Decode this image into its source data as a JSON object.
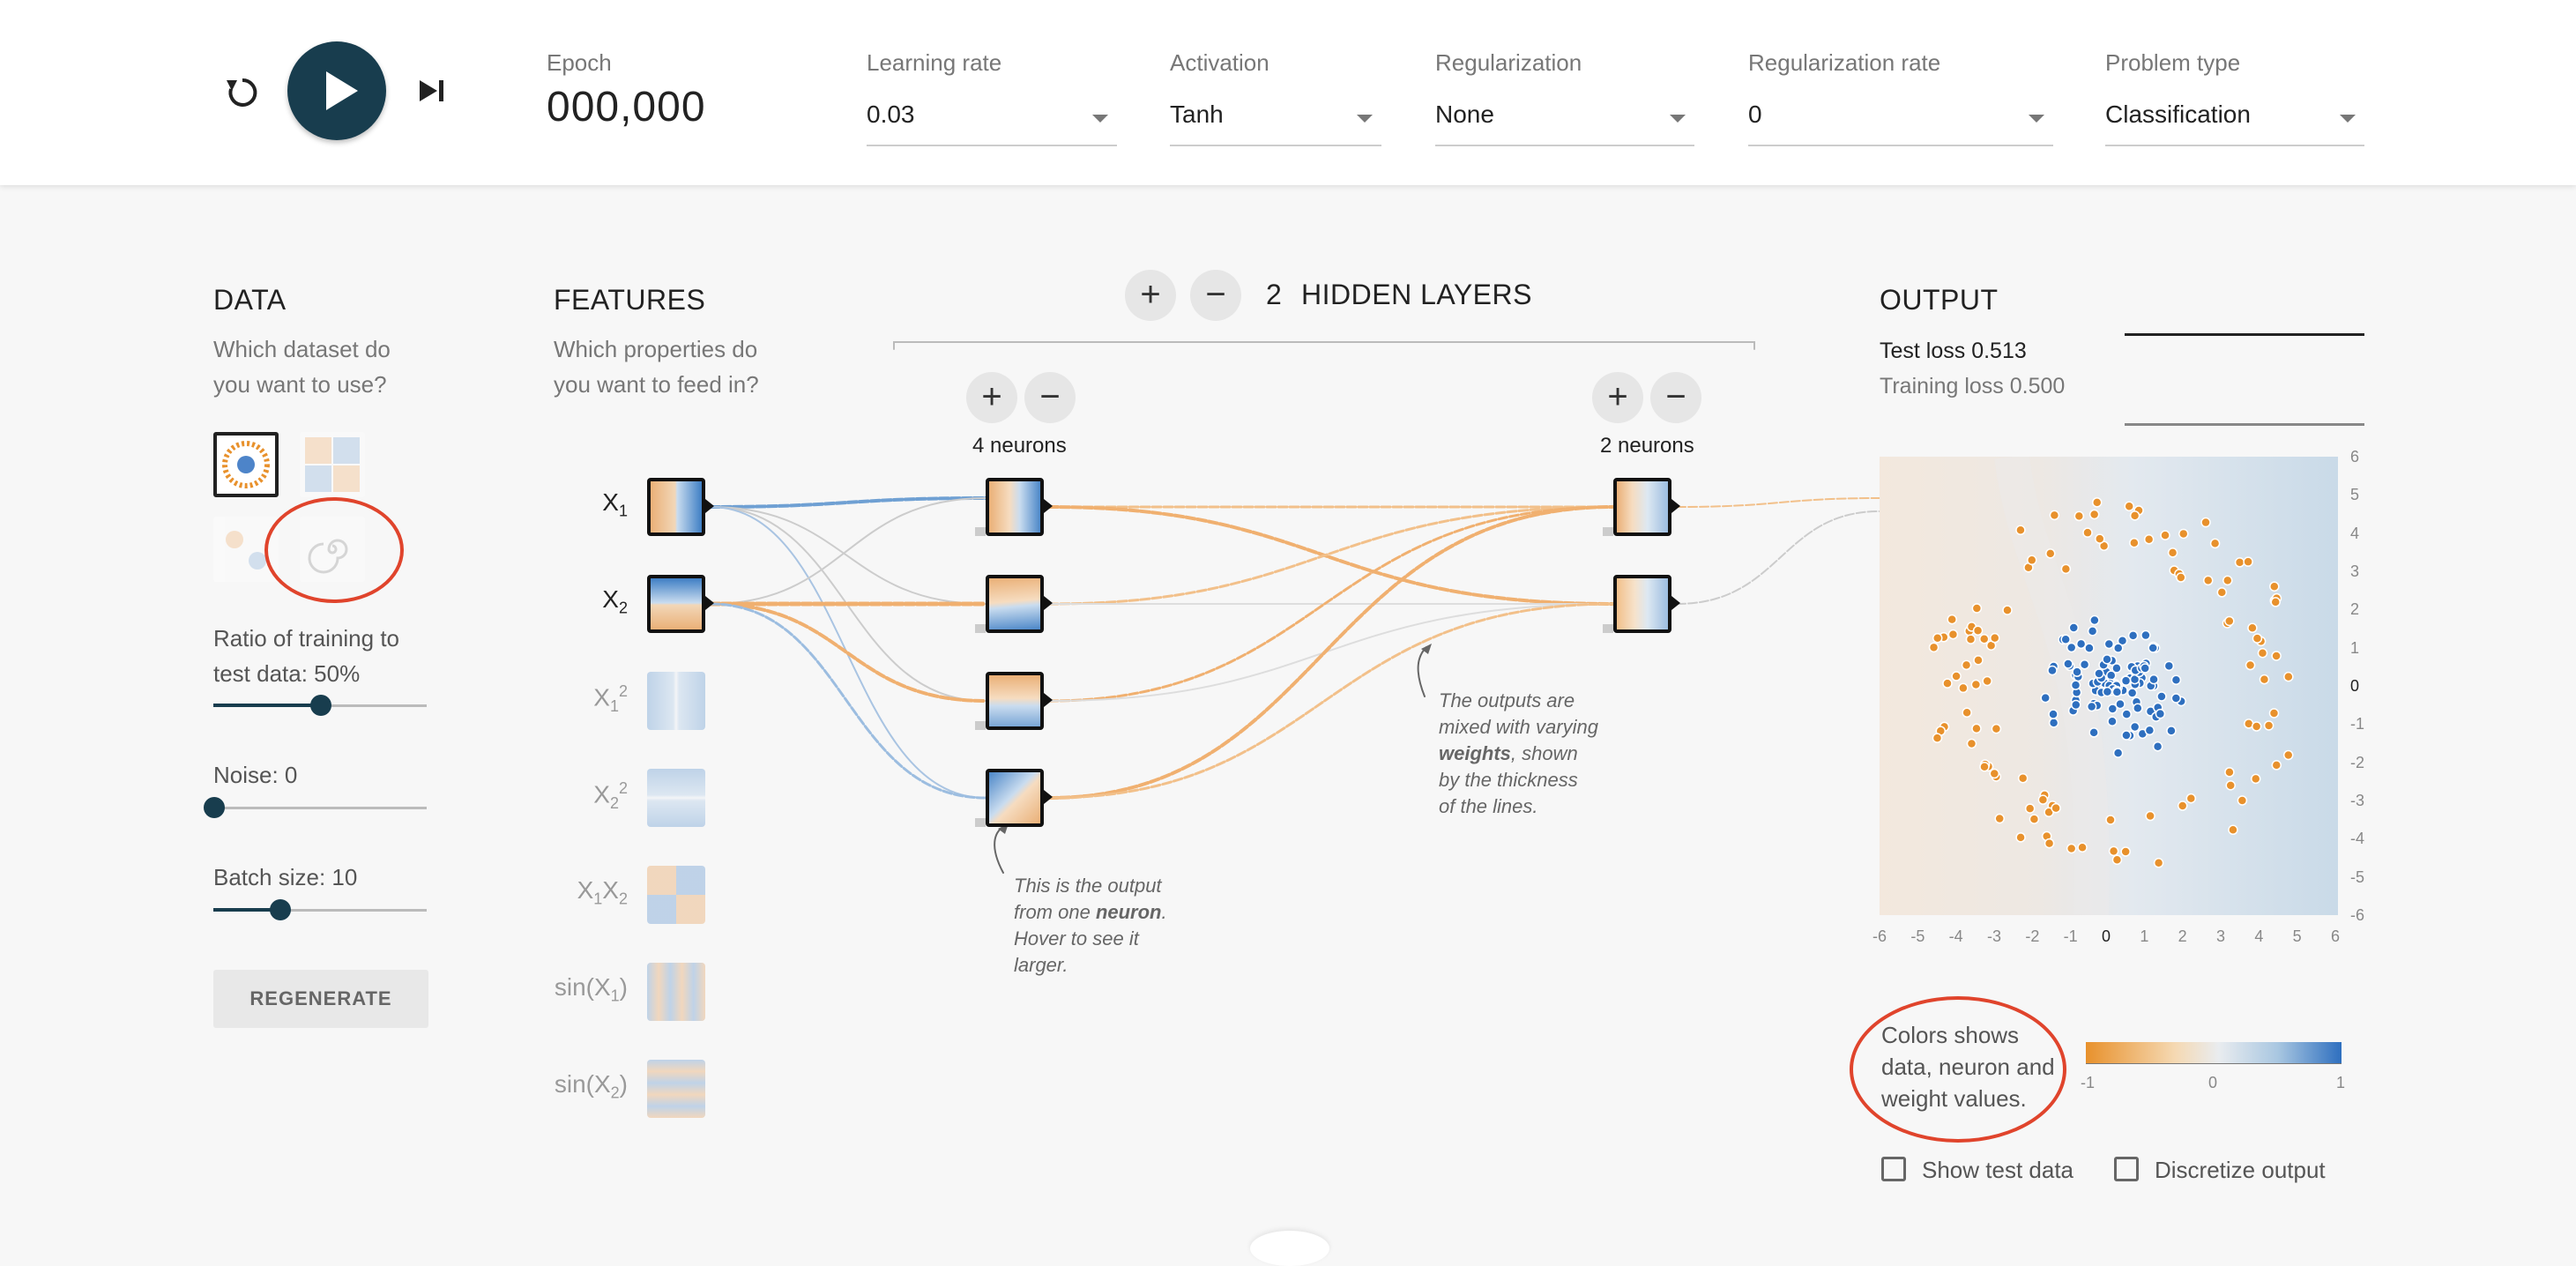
{
  "header": {
    "epoch_label": "Epoch",
    "epoch_value": "000,000",
    "learning_rate": {
      "label": "Learning rate",
      "value": "0.03"
    },
    "activation": {
      "label": "Activation",
      "value": "Tanh"
    },
    "regularization": {
      "label": "Regularization",
      "value": "None"
    },
    "regularization_rate": {
      "label": "Regularization rate",
      "value": "0"
    },
    "problem_type": {
      "label": "Problem type",
      "value": "Classification"
    }
  },
  "data_panel": {
    "title": "DATA",
    "subtitle_line1": "Which dataset do",
    "subtitle_line2": "you want to use?",
    "ratio_label_line1": "Ratio of training to",
    "ratio_label_line2": "test data:  50%",
    "ratio_value": 0.5,
    "noise_label": "Noise:  0",
    "noise_value": 0,
    "batch_label": "Batch size:  10",
    "batch_value": 0.3,
    "regenerate": "REGENERATE"
  },
  "features_panel": {
    "title": "FEATURES",
    "subtitle_line1": "Which properties do",
    "subtitle_line2": "you want to feed in?",
    "features": [
      "X1",
      "X2",
      "X1²",
      "X2²",
      "X1X2",
      "sin(X1)",
      "sin(X2)"
    ]
  },
  "hidden_layers": {
    "count": "2",
    "label": "HIDDEN LAYERS",
    "layer1_neurons": "4 neurons",
    "layer2_neurons": "2 neurons"
  },
  "annotations": {
    "neuron_line1": "This is the output",
    "neuron_line2_pre": "from one ",
    "neuron_line2_bold": "neuron",
    "neuron_line2_post": ".",
    "neuron_line3": "Hover to see it",
    "neuron_line4": "larger.",
    "weights_line1": "The outputs are",
    "weights_line2": "mixed with varying",
    "weights_line3_bold": "weights",
    "weights_line3_post": ", shown",
    "weights_line4": "by the thickness",
    "weights_line5": "of the lines."
  },
  "output": {
    "title": "OUTPUT",
    "test_loss": "Test loss 0.513",
    "training_loss": "Training loss 0.500",
    "x_ticks": [
      "-6",
      "-5",
      "-4",
      "-3",
      "-2",
      "-1",
      "0",
      "1",
      "2",
      "3",
      "4",
      "5",
      "6"
    ],
    "y_ticks": [
      "6",
      "5",
      "4",
      "3",
      "2",
      "1",
      "0",
      "-1",
      "-2",
      "-3",
      "-4",
      "-5",
      "-6"
    ],
    "legend_line1": "Colors shows",
    "legend_line2": "data, neuron and",
    "legend_line3": "weight values.",
    "scale_min": "-1",
    "scale_mid": "0",
    "scale_max": "1",
    "show_test_data": "Show test data",
    "discretize_output": "Discretize output"
  },
  "colors": {
    "accent_dark": "#183d4e",
    "orange": "#e8912c",
    "blue": "#2e6fbf",
    "highlight_red": "#e0442c"
  }
}
